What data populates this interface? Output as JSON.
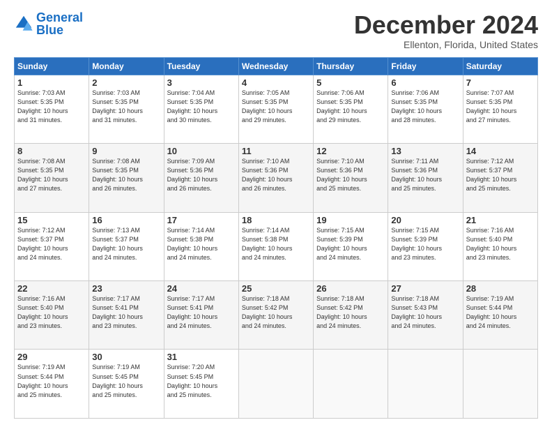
{
  "logo": {
    "line1": "General",
    "line2": "Blue"
  },
  "title": "December 2024",
  "subtitle": "Ellenton, Florida, United States",
  "days_of_week": [
    "Sunday",
    "Monday",
    "Tuesday",
    "Wednesday",
    "Thursday",
    "Friday",
    "Saturday"
  ],
  "weeks": [
    [
      {
        "day": "1",
        "info": "Sunrise: 7:03 AM\nSunset: 5:35 PM\nDaylight: 10 hours\nand 31 minutes."
      },
      {
        "day": "2",
        "info": "Sunrise: 7:03 AM\nSunset: 5:35 PM\nDaylight: 10 hours\nand 31 minutes."
      },
      {
        "day": "3",
        "info": "Sunrise: 7:04 AM\nSunset: 5:35 PM\nDaylight: 10 hours\nand 30 minutes."
      },
      {
        "day": "4",
        "info": "Sunrise: 7:05 AM\nSunset: 5:35 PM\nDaylight: 10 hours\nand 29 minutes."
      },
      {
        "day": "5",
        "info": "Sunrise: 7:06 AM\nSunset: 5:35 PM\nDaylight: 10 hours\nand 29 minutes."
      },
      {
        "day": "6",
        "info": "Sunrise: 7:06 AM\nSunset: 5:35 PM\nDaylight: 10 hours\nand 28 minutes."
      },
      {
        "day": "7",
        "info": "Sunrise: 7:07 AM\nSunset: 5:35 PM\nDaylight: 10 hours\nand 27 minutes."
      }
    ],
    [
      {
        "day": "8",
        "info": "Sunrise: 7:08 AM\nSunset: 5:35 PM\nDaylight: 10 hours\nand 27 minutes."
      },
      {
        "day": "9",
        "info": "Sunrise: 7:08 AM\nSunset: 5:35 PM\nDaylight: 10 hours\nand 26 minutes."
      },
      {
        "day": "10",
        "info": "Sunrise: 7:09 AM\nSunset: 5:36 PM\nDaylight: 10 hours\nand 26 minutes."
      },
      {
        "day": "11",
        "info": "Sunrise: 7:10 AM\nSunset: 5:36 PM\nDaylight: 10 hours\nand 26 minutes."
      },
      {
        "day": "12",
        "info": "Sunrise: 7:10 AM\nSunset: 5:36 PM\nDaylight: 10 hours\nand 25 minutes."
      },
      {
        "day": "13",
        "info": "Sunrise: 7:11 AM\nSunset: 5:36 PM\nDaylight: 10 hours\nand 25 minutes."
      },
      {
        "day": "14",
        "info": "Sunrise: 7:12 AM\nSunset: 5:37 PM\nDaylight: 10 hours\nand 25 minutes."
      }
    ],
    [
      {
        "day": "15",
        "info": "Sunrise: 7:12 AM\nSunset: 5:37 PM\nDaylight: 10 hours\nand 24 minutes."
      },
      {
        "day": "16",
        "info": "Sunrise: 7:13 AM\nSunset: 5:37 PM\nDaylight: 10 hours\nand 24 minutes."
      },
      {
        "day": "17",
        "info": "Sunrise: 7:14 AM\nSunset: 5:38 PM\nDaylight: 10 hours\nand 24 minutes."
      },
      {
        "day": "18",
        "info": "Sunrise: 7:14 AM\nSunset: 5:38 PM\nDaylight: 10 hours\nand 24 minutes."
      },
      {
        "day": "19",
        "info": "Sunrise: 7:15 AM\nSunset: 5:39 PM\nDaylight: 10 hours\nand 24 minutes."
      },
      {
        "day": "20",
        "info": "Sunrise: 7:15 AM\nSunset: 5:39 PM\nDaylight: 10 hours\nand 23 minutes."
      },
      {
        "day": "21",
        "info": "Sunrise: 7:16 AM\nSunset: 5:40 PM\nDaylight: 10 hours\nand 23 minutes."
      }
    ],
    [
      {
        "day": "22",
        "info": "Sunrise: 7:16 AM\nSunset: 5:40 PM\nDaylight: 10 hours\nand 23 minutes."
      },
      {
        "day": "23",
        "info": "Sunrise: 7:17 AM\nSunset: 5:41 PM\nDaylight: 10 hours\nand 23 minutes."
      },
      {
        "day": "24",
        "info": "Sunrise: 7:17 AM\nSunset: 5:41 PM\nDaylight: 10 hours\nand 24 minutes."
      },
      {
        "day": "25",
        "info": "Sunrise: 7:18 AM\nSunset: 5:42 PM\nDaylight: 10 hours\nand 24 minutes."
      },
      {
        "day": "26",
        "info": "Sunrise: 7:18 AM\nSunset: 5:42 PM\nDaylight: 10 hours\nand 24 minutes."
      },
      {
        "day": "27",
        "info": "Sunrise: 7:18 AM\nSunset: 5:43 PM\nDaylight: 10 hours\nand 24 minutes."
      },
      {
        "day": "28",
        "info": "Sunrise: 7:19 AM\nSunset: 5:44 PM\nDaylight: 10 hours\nand 24 minutes."
      }
    ],
    [
      {
        "day": "29",
        "info": "Sunrise: 7:19 AM\nSunset: 5:44 PM\nDaylight: 10 hours\nand 25 minutes."
      },
      {
        "day": "30",
        "info": "Sunrise: 7:19 AM\nSunset: 5:45 PM\nDaylight: 10 hours\nand 25 minutes."
      },
      {
        "day": "31",
        "info": "Sunrise: 7:20 AM\nSunset: 5:45 PM\nDaylight: 10 hours\nand 25 minutes."
      },
      {
        "day": "",
        "info": ""
      },
      {
        "day": "",
        "info": ""
      },
      {
        "day": "",
        "info": ""
      },
      {
        "day": "",
        "info": ""
      }
    ]
  ]
}
